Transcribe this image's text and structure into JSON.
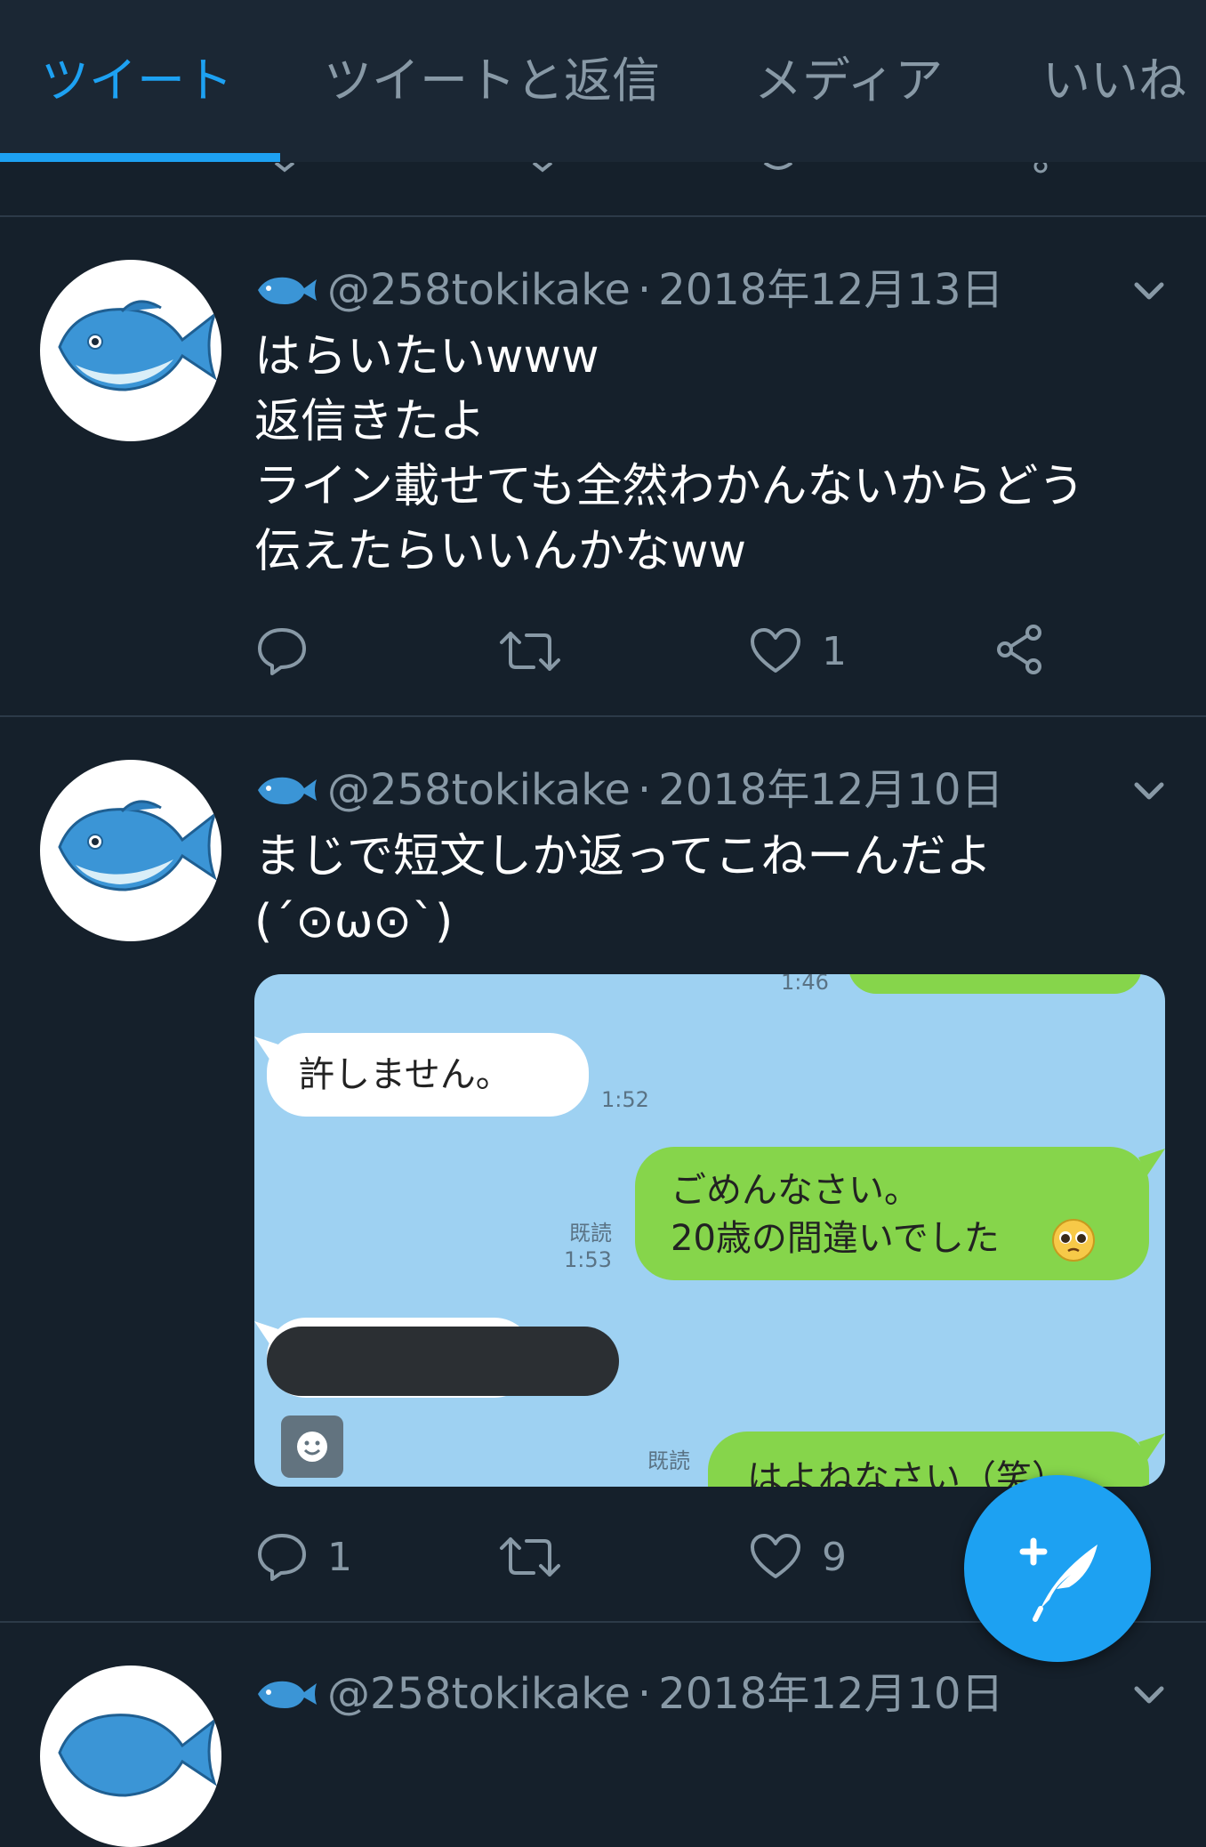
{
  "tabs": [
    {
      "label": "ツイート",
      "active": true
    },
    {
      "label": "ツイートと返信",
      "active": false
    },
    {
      "label": "メディア",
      "active": false
    },
    {
      "label": "いいね",
      "active": false
    }
  ],
  "colors": {
    "accent": "#1da1f2",
    "background": "#15202b",
    "muted": "#8899a6"
  },
  "tweets": [
    {
      "handle": "@258tokikake",
      "separator": "·",
      "date": "2018年12月13日",
      "lines": [
        "はらいたいwww",
        "返信きたよ",
        "ライン載せても全然わかんないからどう",
        "伝えたらいいんかなww"
      ],
      "reply_count": "",
      "retweet_count": "",
      "like_count": "1"
    },
    {
      "handle": "@258tokikake",
      "separator": "·",
      "date": "2018年12月10日",
      "lines": [
        "まじで短文しか返ってこねーんだよ",
        "(´⊙ω⊙`)"
      ],
      "reply_count": "1",
      "retweet_count": "",
      "like_count": "9"
    },
    {
      "handle": "@258tokikake",
      "separator": "·",
      "date": "2018年12月10日"
    }
  ],
  "chat": {
    "top_time": "1:46",
    "msg1": "許しません。",
    "msg1_time": "1:52",
    "msg2_line1": "ごめんなさい。",
    "msg2_line2": "20歳の間違いでした",
    "msg2_read": "既読",
    "msg2_time": "1:53",
    "msg3_read": "既読",
    "msg3": "はよねなさい（笑）"
  },
  "icons": [
    "fish-emoji-icon",
    "chevron-down-icon",
    "reply-icon",
    "retweet-icon",
    "like-icon",
    "share-icon",
    "compose-tweet-icon"
  ]
}
